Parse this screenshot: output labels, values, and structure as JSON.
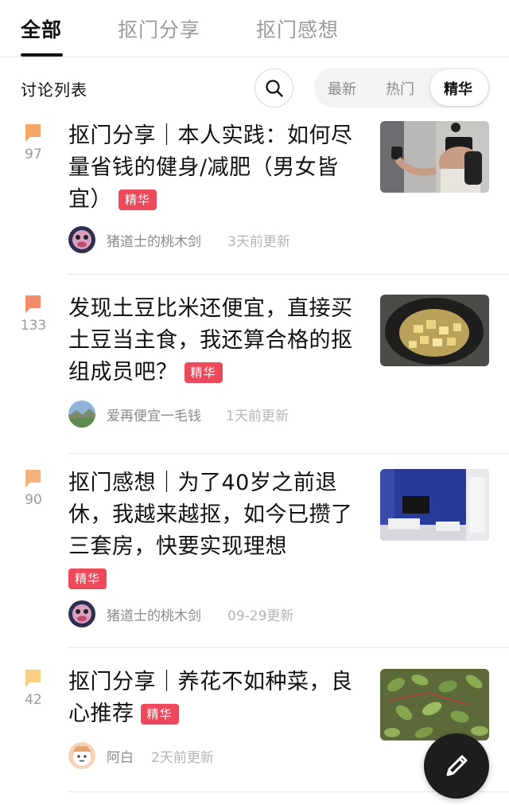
{
  "tabs": [
    {
      "label": "全部",
      "active": true
    },
    {
      "label": "抠门分享",
      "active": false
    },
    {
      "label": "抠门感想",
      "active": false
    }
  ],
  "subheader": {
    "title": "讨论列表",
    "search_icon": "search-icon",
    "sort_options": [
      "最新",
      "热门",
      "精华"
    ],
    "sort_selected": "精华"
  },
  "badge_label": "精华",
  "colors": {
    "badge": "#ec4a5a",
    "reply_icon_levels": [
      "#f5a866",
      "#f28c6a",
      "#f5b27a",
      "#f8cf85"
    ]
  },
  "posts": [
    {
      "replies": "97",
      "title": "抠门分享｜本人实践：如何尽量省钱的健身/减肥（男女皆宜）",
      "badge": "精华",
      "author": "猪道士的桃木剑",
      "updated": "3天前更新",
      "thumbnail": "mirror-selfie-photo"
    },
    {
      "replies": "133",
      "title": "发现土豆比米还便宜，直接买土豆当主食，我还算合格的抠组成员吧？",
      "badge": "精华",
      "author": "爱再便宜一毛钱",
      "updated": "1天前更新",
      "thumbnail": "potato-wok-photo"
    },
    {
      "replies": "90",
      "title": "抠门感想｜为了40岁之前退休，我越来越抠，如今已攒了三套房，快要实现理想",
      "badge": "精华",
      "author": "猪道士的桃木剑",
      "updated": "09-29更新",
      "thumbnail": "blue-room-photo"
    },
    {
      "replies": "42",
      "title": "抠门分享｜养花不如种菜，良心推荐",
      "badge": "精华",
      "author": "阿白",
      "updated": "2天前更新",
      "thumbnail": "purslane-plant-photo"
    }
  ],
  "fab_icon": "pencil-icon"
}
